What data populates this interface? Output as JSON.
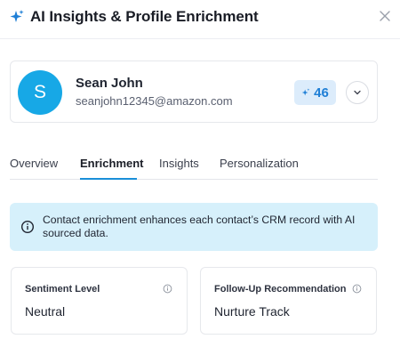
{
  "header": {
    "title": "AI Insights & Profile Enrichment",
    "icon": "sparkle-icon",
    "close_icon": "close-icon"
  },
  "profile": {
    "initial": "S",
    "name": "Sean John",
    "email": "seanjohn12345@amazon.com",
    "score": "46",
    "avatar_color": "#17a8e6",
    "badge_color": "#dcecfb"
  },
  "tabs": [
    {
      "label": "Overview",
      "active": false
    },
    {
      "label": "Enrichment",
      "active": true
    },
    {
      "label": "Insights",
      "active": false
    },
    {
      "label": "Personalization",
      "active": false
    }
  ],
  "banner": {
    "text": "Contact enrichment enhances each contact’s CRM record with AI sourced data.",
    "color": "#d6f0fb"
  },
  "metrics": [
    {
      "label": "Sentiment Level",
      "value": "Neutral"
    },
    {
      "label": "Follow-Up Recommendation",
      "value": "Nurture Track"
    }
  ],
  "colors": {
    "accent": "#1a8fd8",
    "score_text": "#1f7fd6"
  }
}
